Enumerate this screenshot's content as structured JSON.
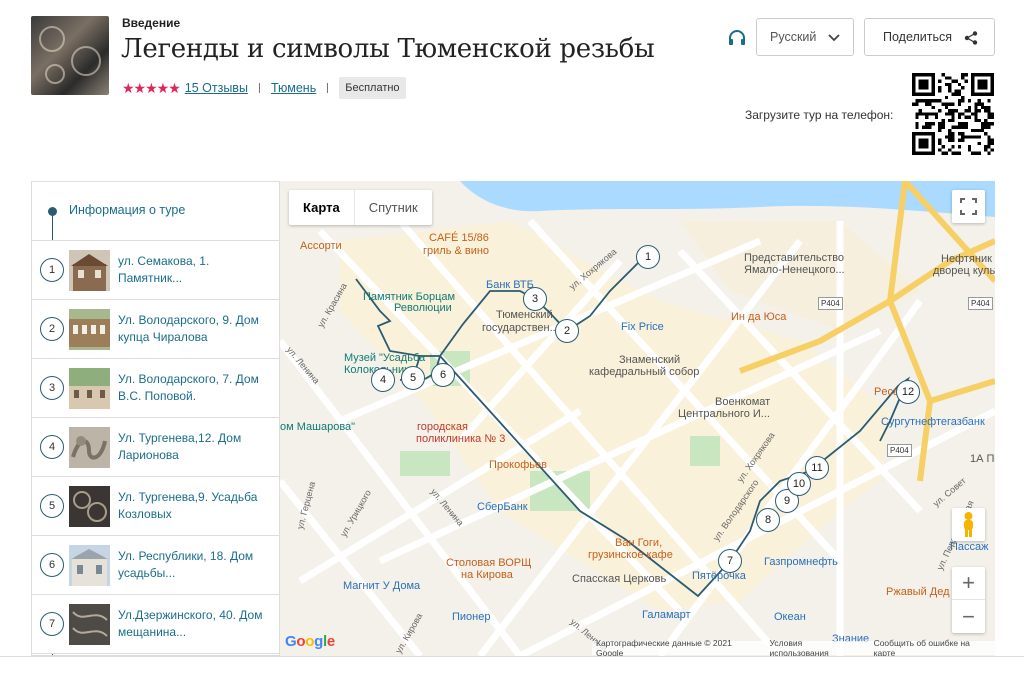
{
  "header": {
    "section_label": "Введение",
    "title": "Легенды и символы Тюменской резьбы",
    "rating_stars": "★★★★★",
    "reviews_link": "15 Отзывы",
    "city_link": "Тюмень",
    "price_badge": "Бесплатно",
    "language": "Русский",
    "share_label": "Поделиться",
    "qr_label": "Загрузите тур на телефон:"
  },
  "sidebar": {
    "info_label": "Информация о туре",
    "stops": [
      {
        "num": "1",
        "label": "ул. Семакова, 1. Памятник..."
      },
      {
        "num": "2",
        "label": "Ул. Володарского, 9. Дом купца Чиралова"
      },
      {
        "num": "3",
        "label": "Ул. Володарского, 7. Дом В.С. Поповой."
      },
      {
        "num": "4",
        "label": "Ул. Тургенева,12. Дом Ларионова"
      },
      {
        "num": "5",
        "label": "Ул. Тургенева,9. Усадьба Козловых"
      },
      {
        "num": "6",
        "label": "Ул. Республики, 18. Дом усадьбы..."
      },
      {
        "num": "7",
        "label": "Ул.Дзержинского, 40. Дом мещанина..."
      }
    ]
  },
  "map": {
    "tab_map": "Карта",
    "tab_satellite": "Спутник",
    "zoom_in": "+",
    "zoom_out": "−",
    "google_logo": [
      "G",
      "o",
      "o",
      "g",
      "l",
      "e"
    ],
    "attribution": [
      "Картографические данные © 2021 Google",
      "Условия использования",
      "Сообщить об ошибке на карте"
    ],
    "route_markers": [
      "1",
      "2",
      "3",
      "4",
      "5",
      "6",
      "7",
      "8",
      "9",
      "10",
      "11",
      "12"
    ],
    "labels": {
      "assorti": "Ассорти",
      "cafe": "CAFÉ 15/86",
      "cafe2": "гриль & вино",
      "vtb": "Банк ВТБ",
      "pamyatnik1": "Памятник Борцам",
      "pamyatnik2": "Революции",
      "tyum1": "Тюменский",
      "tyum2": "государствен...",
      "muzey1": "Музей \"Усадьба",
      "muzey2": "Колокольнико...",
      "mashar": "ом Машарова\"",
      "polik1": "городская",
      "polik2": "поликлиника № 3",
      "prokofiev": "Прокофьев",
      "sber": "СберБанк",
      "vangogi1": "Ван Гоги,",
      "vangogi2": "грузинское кафе",
      "borsh1": "Столовая ВОРЩ",
      "borsh2": "на Кирова",
      "spass": "Спасская Церковь",
      "magnit": "Магнит У Дома",
      "pioner": "Пионер",
      "galamart": "Галамарт",
      "okean": "Океан",
      "pyaterochka": "Пятёрочка",
      "gazprom": "Газпромнефть",
      "znam1": "Знаменский",
      "znam2": "кафедральный собор",
      "voenkomat1": "Военкомат",
      "voenkomat2": "Центрального И...",
      "fixprice": "Fix Price",
      "predst1": "Представительство",
      "predst2": "Ямало-Ненецкого...",
      "indayusa": "Ин да Юса",
      "neft1": "Нефтяник",
      "neft2": "дворец культуры",
      "pecado": "Pecado",
      "surgut": "Сургутнефтегазбанк",
      "onea": "1А По",
      "passazh": "Пассаж",
      "rzhavy": "Ржавый Дед",
      "znanie": "Знание",
      "r_krasina": "ул. Красина",
      "r_lenina": "ул. Ленина",
      "r_lenina2": "ул. Ленина",
      "r_lenina3": "ул. Ленина",
      "r_urick": "ул. Урицкого",
      "r_gercena": "ул. Герцена",
      "r_kirova": "ул. Кирова",
      "r_hohryakova": "ул. Хохрякова",
      "r_hohryakova2": "ул. Хохрякова",
      "r_volod": "ул. Володарского",
      "r_pervom": "ул. Первомайская",
      "r_sovet": "ул. Совет",
      "r_p404": "Р404",
      "r_p404b": "Р404",
      "r_p404c": "Р404"
    }
  },
  "colors": {
    "accent": "#1a6d8a",
    "route": "#2b5b72",
    "stars": "#e2245a",
    "river": "#aadaff",
    "highway": "#f6cf65"
  }
}
